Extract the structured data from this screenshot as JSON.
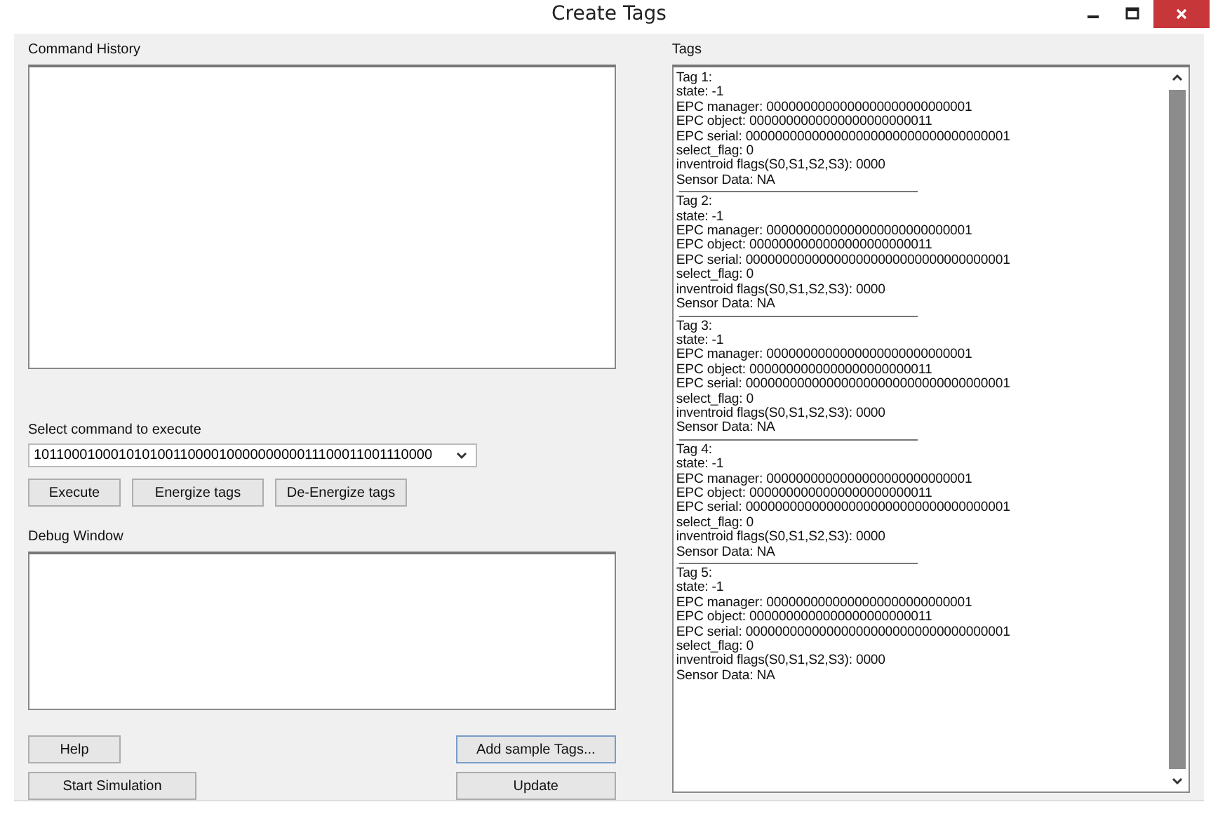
{
  "window": {
    "title": "Create Tags"
  },
  "command_history": {
    "label": "Command History"
  },
  "command_select": {
    "label": "Select command to execute",
    "value": "1011000100010101001100001000000000011100011001110000"
  },
  "command_buttons": [
    "Execute",
    "Energize tags",
    "De-Energize tags"
  ],
  "debug_window": {
    "label": "Debug Window"
  },
  "bottom_left_buttons": [
    "Help",
    "Start Simulation"
  ],
  "bottom_right_buttons": [
    "Add sample Tags...",
    "Update"
  ],
  "tags_panel": {
    "label": "Tags",
    "tags": [
      {
        "lines": [
          "Tag 1:",
          "state: -1",
          "EPC manager: 0000000000000000000000000001",
          "EPC object: 0000000000000000000000011",
          "EPC serial: 000000000000000000000000000000000001",
          "select_flag: 0",
          "inventroid flags(S0,S1,S2,S3): 0000",
          "Sensor Data: NA"
        ]
      },
      {
        "lines": [
          "Tag 2:",
          "state: -1",
          "EPC manager: 0000000000000000000000000001",
          "EPC object: 0000000000000000000000011",
          "EPC serial: 000000000000000000000000000000000001",
          "select_flag: 0",
          "inventroid flags(S0,S1,S2,S3): 0000",
          "Sensor Data: NA"
        ]
      },
      {
        "lines": [
          "Tag 3:",
          "state: -1",
          "EPC manager: 0000000000000000000000000001",
          "EPC object: 0000000000000000000000011",
          "EPC serial: 000000000000000000000000000000000001",
          "select_flag: 0",
          "inventroid flags(S0,S1,S2,S3): 0000",
          "Sensor Data: NA"
        ]
      },
      {
        "lines": [
          "Tag 4:",
          "state: -1",
          "EPC manager: 0000000000000000000000000001",
          "EPC object: 0000000000000000000000011",
          "EPC serial: 000000000000000000000000000000000001",
          "select_flag: 0",
          "inventroid flags(S0,S1,S2,S3): 0000",
          "Sensor Data: NA"
        ]
      },
      {
        "lines": [
          "Tag 5:",
          "state: -1",
          "EPC manager: 0000000000000000000000000001",
          "EPC object: 0000000000000000000000011",
          "EPC serial: 000000000000000000000000000000000001",
          "select_flag: 0",
          "inventroid flags(S0,S1,S2,S3): 0000",
          "Sensor Data: NA"
        ]
      }
    ]
  }
}
